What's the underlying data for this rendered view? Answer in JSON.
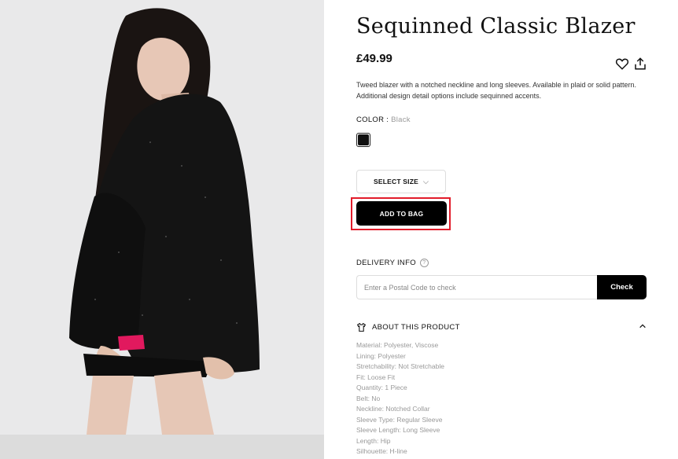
{
  "product": {
    "title": "Sequinned Classic Blazer",
    "price": "£49.99",
    "description": "Tweed blazer with a notched neckline and long sleeves. Available in plaid or solid pattern. Additional design detail options include sequinned accents."
  },
  "color": {
    "label": "COLOR :",
    "value": "Black",
    "swatch_hex": "#111111"
  },
  "size": {
    "label": "SELECT SIZE"
  },
  "add_to_bag": {
    "label": "ADD TO BAG"
  },
  "delivery": {
    "label": "DELIVERY INFO",
    "placeholder": "Enter a Postal Code to check",
    "check_label": "Check"
  },
  "about": {
    "label": "ABOUT THIS PRODUCT",
    "specs": [
      "Material: Polyester, Viscose",
      "Lining: Polyester",
      "Stretchability: Not Stretchable",
      "Fit: Loose Fit",
      "Quantity: 1 Piece",
      "Belt: No",
      "Neckline: Notched Collar",
      "Sleeve Type: Regular Sleeve",
      "Sleeve Length: Long Sleeve",
      "Length: Hip",
      "Silhouette: H-line"
    ]
  },
  "icons": {
    "wishlist": "heart-icon",
    "share": "share-icon",
    "info": "info-icon",
    "about": "shirt-icon",
    "collapse": "chevron-up-icon",
    "size_dropdown": "chevron-down-icon"
  },
  "colors": {
    "accent": "#000000",
    "highlight": "#e21c2a",
    "muted_text": "#999999"
  }
}
